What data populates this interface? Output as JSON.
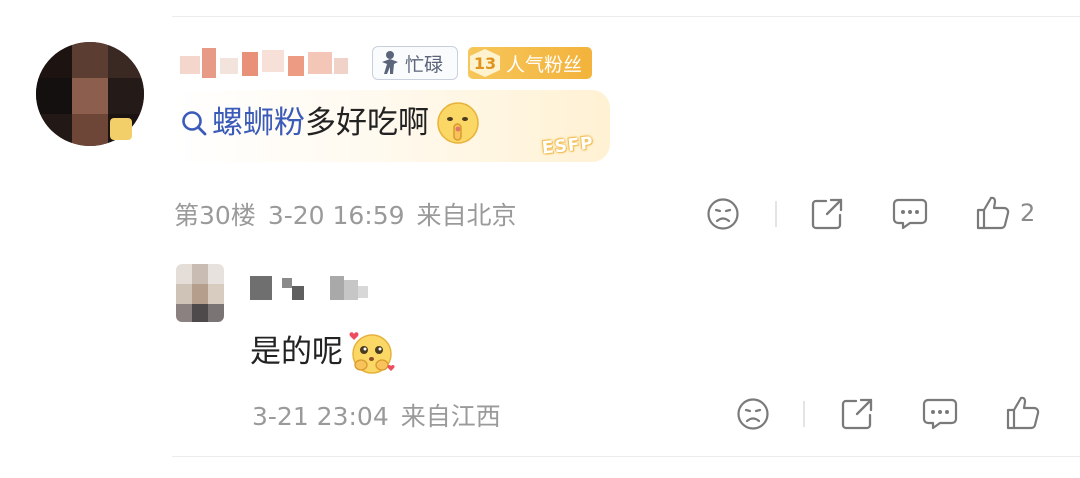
{
  "comment": {
    "user_badge_busy": "忙碌",
    "user_badge_level": "13",
    "user_badge_fan": "人气粉丝",
    "search_keyword": "螺蛳粉",
    "text": "多好吃啊",
    "emoji_icon": "shush-face-icon",
    "personality_tag": "ESFP",
    "floor": "第30楼",
    "time": "3-20 16:59",
    "location": "来自北京",
    "like_count": "2"
  },
  "reply": {
    "text": "是的呢",
    "emoji_icon": "pleading-face-icon",
    "time": "3-21 23:04",
    "location": "来自江西"
  },
  "colors": {
    "keyword_blue": "#3b5bb8",
    "meta_gray": "#9a9a9a",
    "fan_badge_gold": "#f3b33c"
  }
}
